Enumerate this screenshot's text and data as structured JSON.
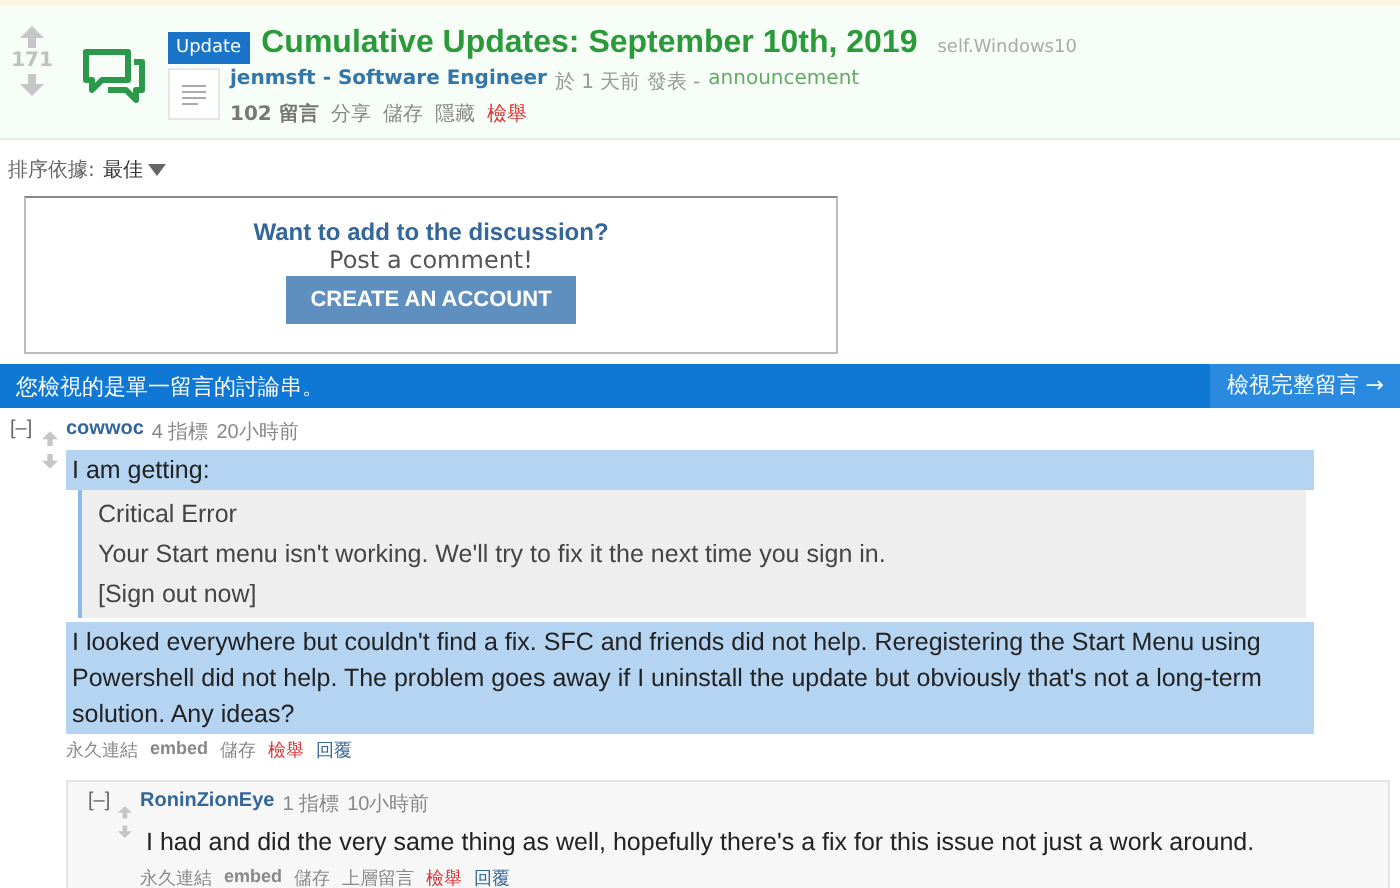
{
  "post": {
    "score": "171",
    "flair": "Update",
    "title": "Cumulative Updates: September 10th, 2019",
    "domain": "self.Windows10",
    "author": "jenmsft - Software Engineer",
    "meta": "於 1 天前 發表 -",
    "flair_text": "announcement",
    "actions": [
      {
        "label": "102 留言",
        "kind": "bold"
      },
      {
        "label": "分享",
        "kind": "plain"
      },
      {
        "label": "儲存",
        "kind": "plain"
      },
      {
        "label": "隱藏",
        "kind": "plain"
      },
      {
        "label": "檢舉",
        "kind": "report"
      }
    ]
  },
  "sort": {
    "label": "排序依據:",
    "value": "最佳"
  },
  "signup": {
    "heading": "Want to add to the discussion?",
    "subheading": "Post a comment!",
    "button": "CREATE AN ACCOUNT"
  },
  "thread_bar": {
    "message": "您檢視的是單一留言的討論串。",
    "link": "檢視完整留言 →"
  },
  "comments": [
    {
      "toggle": "[–]",
      "author": "cowwoc",
      "points": "4 指標",
      "time": "20小時前",
      "highlighted": true,
      "body": [
        {
          "kind": "para",
          "text": "I am getting:"
        },
        {
          "kind": "quote",
          "lines": [
            "Critical Error",
            "Your Start menu isn't working. We'll try to fix it the next time you sign in.",
            "[Sign out now]"
          ]
        },
        {
          "kind": "para",
          "text": "I looked everywhere but couldn't find a fix. SFC and friends did not help. Reregistering the Start Menu using Powershell did not help. The problem goes away if I uninstall the update but obviously that's not a long-term solution. Any ideas?"
        }
      ],
      "actions": [
        {
          "label": "永久連結",
          "kind": "plain"
        },
        {
          "label": "embed",
          "kind": "bold"
        },
        {
          "label": "儲存",
          "kind": "plain"
        },
        {
          "label": "檢舉",
          "kind": "report"
        },
        {
          "label": "回覆",
          "kind": "reply"
        }
      ],
      "children": [
        {
          "toggle": "[–]",
          "author": "RoninZionEye",
          "points": "1 指標",
          "time": "10小時前",
          "highlighted": false,
          "body": [
            {
              "kind": "para",
              "text": "I had and did the very same thing as well, hopefully there's a fix for this issue not just a work around."
            }
          ],
          "actions": [
            {
              "label": "永久連結",
              "kind": "plain"
            },
            {
              "label": "embed",
              "kind": "bold"
            },
            {
              "label": "儲存",
              "kind": "plain"
            },
            {
              "label": "上層留言",
              "kind": "plain"
            },
            {
              "label": "檢舉",
              "kind": "report"
            },
            {
              "label": "回覆",
              "kind": "reply"
            }
          ]
        }
      ]
    }
  ]
}
